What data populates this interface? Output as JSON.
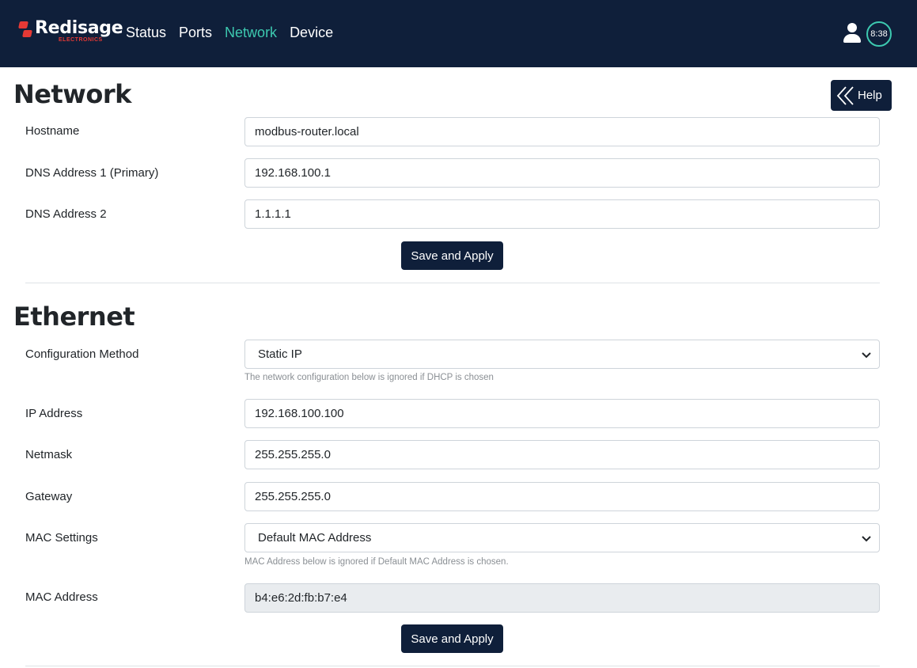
{
  "brand": {
    "name": "Redisage",
    "sub": "ELECTRONICS"
  },
  "nav": [
    {
      "label": "Status",
      "active": false
    },
    {
      "label": "Ports",
      "active": false
    },
    {
      "label": "Network",
      "active": true
    },
    {
      "label": "Device",
      "active": false
    }
  ],
  "header": {
    "timer": "8:38"
  },
  "help": {
    "label": "Help"
  },
  "network": {
    "title": "Network",
    "hostname": {
      "label": "Hostname",
      "value": "modbus-router.local"
    },
    "dns1": {
      "label": "DNS Address 1 (Primary)",
      "value": "192.168.100.1"
    },
    "dns2": {
      "label": "DNS Address 2",
      "value": "1.1.1.1"
    },
    "save": "Save and Apply"
  },
  "ethernet": {
    "title": "Ethernet",
    "method": {
      "label": "Configuration Method",
      "value": "Static IP",
      "hint": "The network configuration below is ignored if DHCP is chosen"
    },
    "ip": {
      "label": "IP Address",
      "value": "192.168.100.100"
    },
    "netmask": {
      "label": "Netmask",
      "value": "255.255.255.0"
    },
    "gateway": {
      "label": "Gateway",
      "value": "255.255.255.0"
    },
    "mac_settings": {
      "label": "MAC Settings",
      "value": "Default MAC Address",
      "hint": "MAC Address below is ignored if Default MAC Address is chosen."
    },
    "mac": {
      "label": "MAC Address",
      "value": "b4:e6:2d:fb:b7:e4"
    },
    "save": "Save and Apply"
  },
  "colors": {
    "navbar": "#0f1f3a",
    "accent": "#3dc9b0",
    "brand_red": "#e53935"
  }
}
